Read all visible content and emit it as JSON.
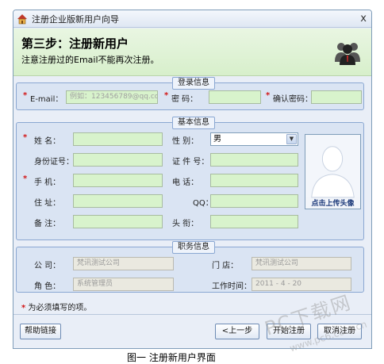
{
  "window": {
    "title": "注册企业版新用户向导",
    "close_glyph": "x"
  },
  "banner": {
    "step_title": "第三步：注册新用户",
    "note": "注意注册过的Email不能再次注册。"
  },
  "login_group": {
    "legend": "登录信息",
    "email_label": "E-mail：",
    "email_placeholder": "例如：123456789@qq.com",
    "password_label": "密    码：",
    "confirm_label": "确认密码："
  },
  "basic_group": {
    "legend": "基本信息",
    "name_label": "姓    名：",
    "gender_label": "性    别：",
    "gender_value": "男",
    "idcard_label": "身份证号：",
    "cert_label": "证 件 号：",
    "mobile_label": "手    机：",
    "phone_label": "电    话：",
    "address_label": "住    址：",
    "qq_label": "QQ：",
    "remark_label": "备    注：",
    "title_label": "头    衔：",
    "photo_label": "点击上传头像"
  },
  "job_group": {
    "legend": "职务信息",
    "company_label": "公    司：",
    "company_value": "梵讯测试公司",
    "store_label": "门    店：",
    "store_value": "梵讯测试公司",
    "role_label": "角    色：",
    "role_value": "系统管理员",
    "worktime_label": "工作时间：",
    "worktime_value": "2011 - 4 - 20"
  },
  "required_note": "为必须填写的项。",
  "required_mark": "*",
  "buttons": {
    "help": "帮助链接",
    "prev": "<上一步",
    "start": "开始注册",
    "cancel": "取消注册"
  },
  "watermark": "PC下载网",
  "watermark_url": "www.pc6.com.cn",
  "caption": "图一 注册新用户界面",
  "colors": {
    "required": "#d21414",
    "input_fill": "#d8f3cc",
    "banner": "#d7efcb"
  }
}
